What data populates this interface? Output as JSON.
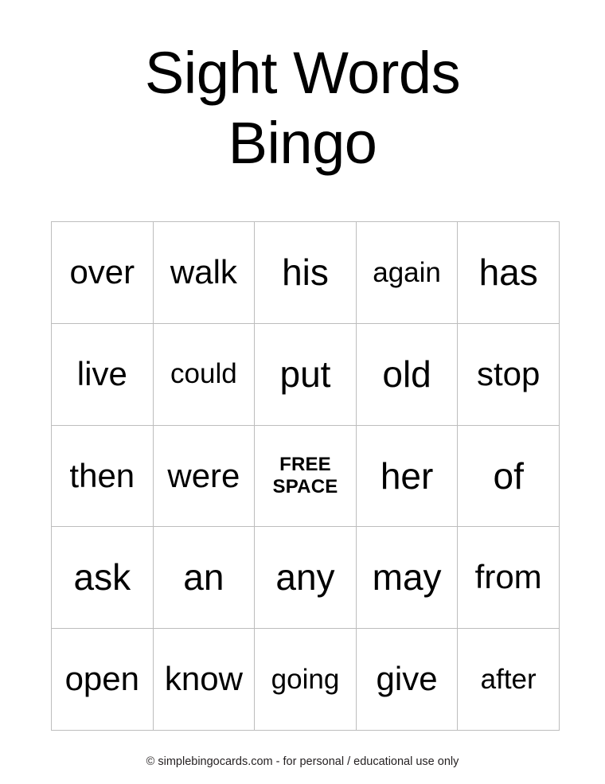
{
  "document": {
    "title_lines": [
      "Sight Words",
      "Bingo"
    ],
    "background_color": "#ffffff",
    "text_color": "#000000",
    "grid_border_color": "#bdbdbd"
  },
  "card": {
    "columns": 5,
    "rows": 5,
    "free_space": {
      "line1": "FREE",
      "line2": "SPACE",
      "row": 3,
      "column": 3
    },
    "grid": [
      [
        {
          "text": "over",
          "size": "len4"
        },
        {
          "text": "walk",
          "size": "len4"
        },
        {
          "text": "his",
          "size": "len3"
        },
        {
          "text": "again",
          "size": "len5"
        },
        {
          "text": "has",
          "size": "len3"
        }
      ],
      [
        {
          "text": "live",
          "size": "len4"
        },
        {
          "text": "could",
          "size": "len5"
        },
        {
          "text": "put",
          "size": "len3"
        },
        {
          "text": "old",
          "size": "len3"
        },
        {
          "text": "stop",
          "size": "len4"
        }
      ],
      [
        {
          "text": "then",
          "size": "len4"
        },
        {
          "text": "were",
          "size": "len4"
        },
        {
          "text": "FREE SPACE",
          "size": "free"
        },
        {
          "text": "her",
          "size": "len3"
        },
        {
          "text": "of",
          "size": "len2"
        }
      ],
      [
        {
          "text": "ask",
          "size": "len3"
        },
        {
          "text": "an",
          "size": "len2"
        },
        {
          "text": "any",
          "size": "len3"
        },
        {
          "text": "may",
          "size": "len3"
        },
        {
          "text": "from",
          "size": "len4"
        }
      ],
      [
        {
          "text": "open",
          "size": "len4"
        },
        {
          "text": "know",
          "size": "len4"
        },
        {
          "text": "going",
          "size": "len5"
        },
        {
          "text": "give",
          "size": "len4"
        },
        {
          "text": "after",
          "size": "len5"
        }
      ]
    ]
  },
  "footer": {
    "credit": "© simplebingocards.com - for personal / educational use only"
  }
}
